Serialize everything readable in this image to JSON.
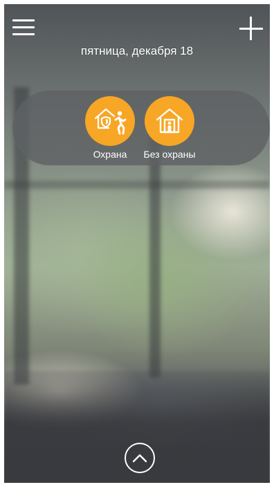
{
  "header": {
    "date": "пятница, декабря 18"
  },
  "icons": {
    "menu": "hamburger-menu-icon",
    "add": "plus-icon",
    "expand": "chevron-up-icon",
    "arm": "house-shield-person-running-icon",
    "disarm": "house-person-icon"
  },
  "modes": [
    {
      "label": "Охрана"
    },
    {
      "label": "Без охраны"
    }
  ],
  "colors": {
    "accent": "#f7a625",
    "panel": "#5f6264",
    "text": "#ffffff"
  }
}
